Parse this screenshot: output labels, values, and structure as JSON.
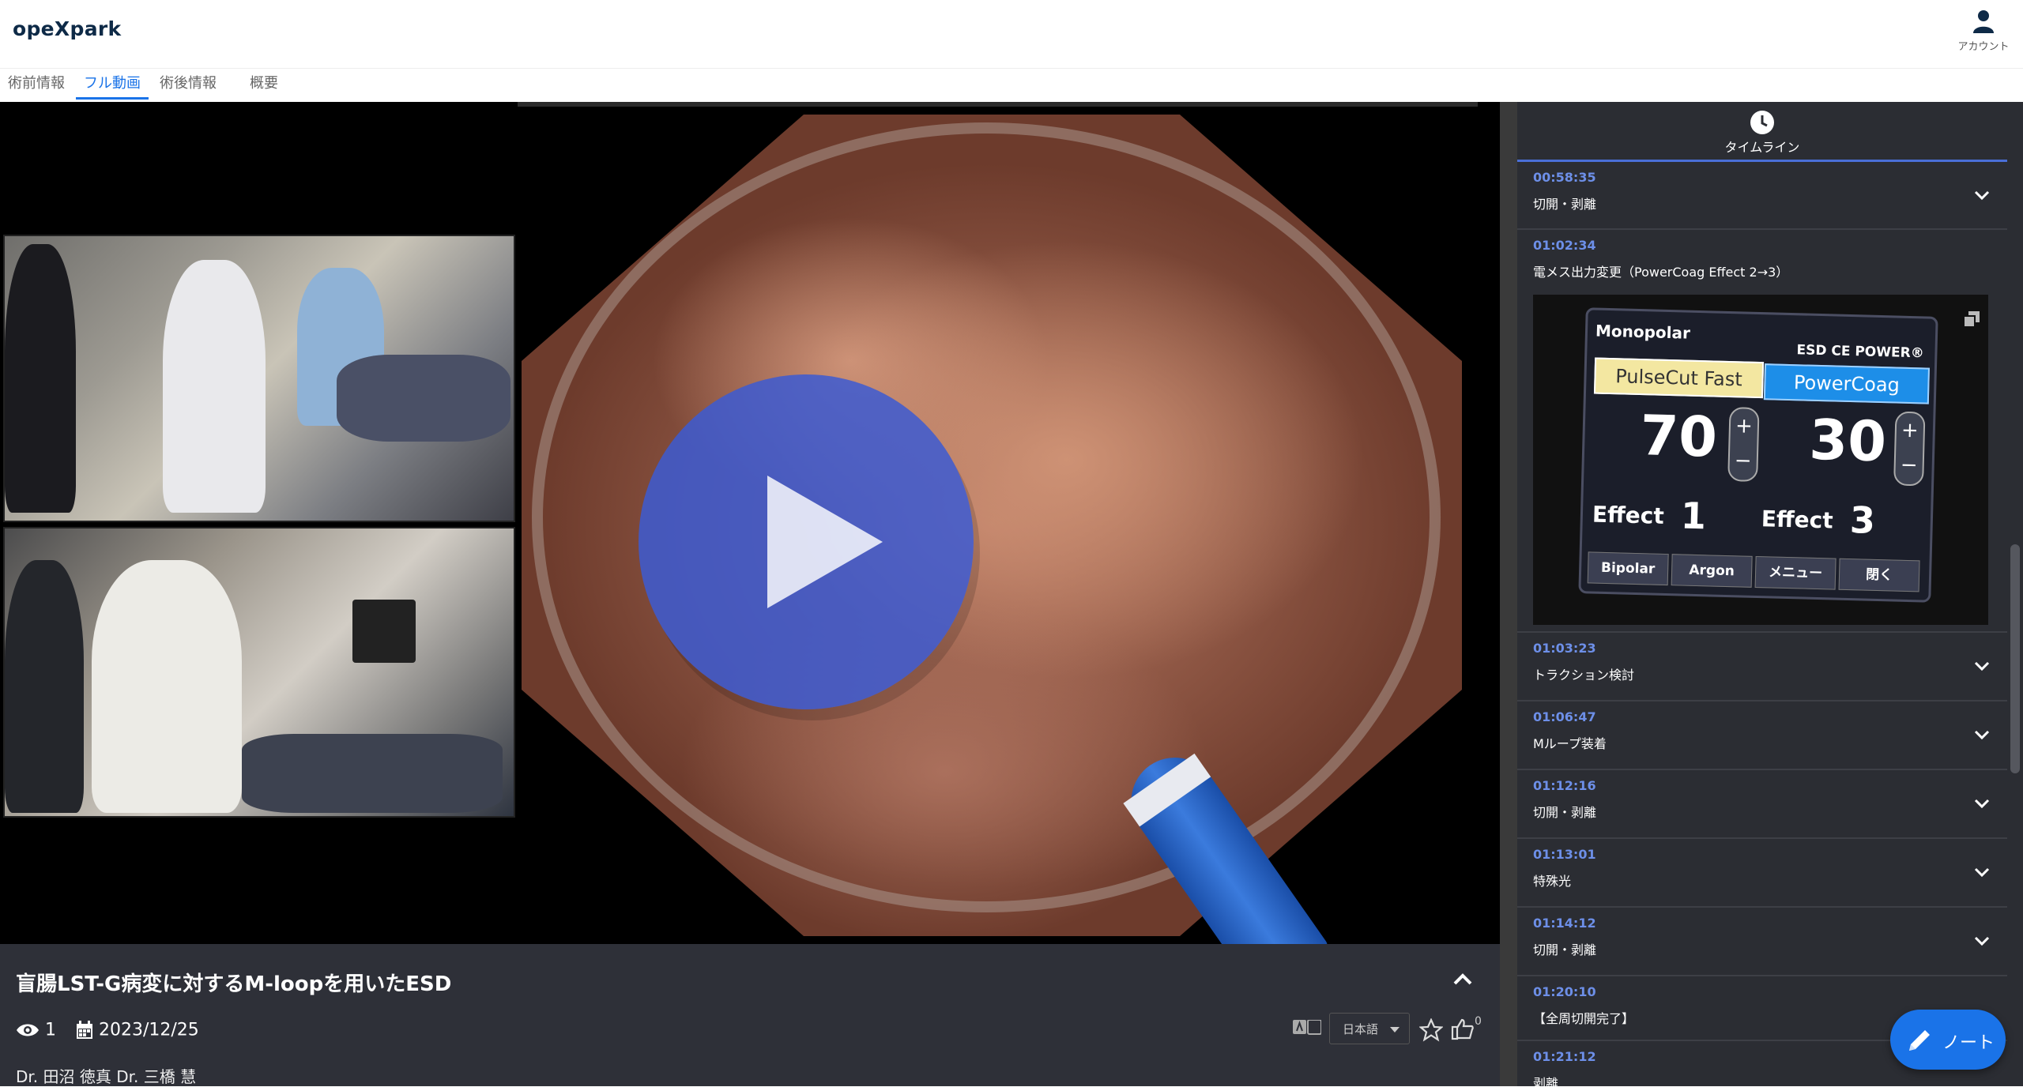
{
  "app": {
    "brand": "opeXpark",
    "account_label": "アカウント"
  },
  "tabs": [
    {
      "label": "術前情報",
      "active": false
    },
    {
      "label": "フル動画",
      "active": true
    },
    {
      "label": "術後情報",
      "active": false
    },
    {
      "label": "概要",
      "active": false
    }
  ],
  "video": {
    "title": "盲腸LST-G病変に対するM-loopを用いたESD",
    "views": "1",
    "date": "2023/12/25",
    "authors": "Dr. 田沼 徳真  Dr. 三橋 慧",
    "language": "日本語",
    "likes": "0",
    "watermark": "opeXpark"
  },
  "timeline": {
    "header": "タイムライン",
    "items": [
      {
        "time": "00:58:35",
        "label": "切開・剥離",
        "expanded": false
      },
      {
        "time": "01:02:34",
        "label": "電メス出力変更（PowerCoag Effect 2→3）",
        "expanded": true
      },
      {
        "time": "01:03:23",
        "label": "トラクション検討",
        "expanded": false
      },
      {
        "time": "01:06:47",
        "label": "Mループ装着",
        "expanded": false
      },
      {
        "time": "01:12:16",
        "label": "切開・剥離",
        "expanded": false
      },
      {
        "time": "01:13:01",
        "label": "特殊光",
        "expanded": false
      },
      {
        "time": "01:14:12",
        "label": "切開・剥離",
        "expanded": false
      },
      {
        "time": "01:20:10",
        "label": "【全周切開完了】",
        "expanded": false
      },
      {
        "time": "01:21:12",
        "label": "剥離",
        "expanded": false
      }
    ],
    "generator_panel": {
      "mode": "Monopolar",
      "model": "ESD CE POWER®",
      "cut_mode": "PulseCut Fast",
      "coag_mode": "PowerCoag",
      "cut_value": "70",
      "coag_value": "30",
      "effect_label": "Effect",
      "cut_effect": "1",
      "coag_effect": "3",
      "plus": "+",
      "minus": "−",
      "buttons": [
        "Bipolar",
        "Argon",
        "メニュー",
        "閉く"
      ]
    }
  },
  "note_button": {
    "label": "ノート"
  },
  "colors": {
    "accent": "#1a73e8",
    "timeline_time": "#6d8fe8",
    "play_button": "#3c5ad2",
    "panel_bg": "#2e3038"
  },
  "icons": [
    "account-icon",
    "clock-icon",
    "chevron-down-icon",
    "chevron-up-icon",
    "eye-icon",
    "calendar-icon",
    "translate-icon",
    "star-icon",
    "thumbs-up-icon",
    "pencil-icon",
    "copy-icon",
    "play-icon"
  ]
}
